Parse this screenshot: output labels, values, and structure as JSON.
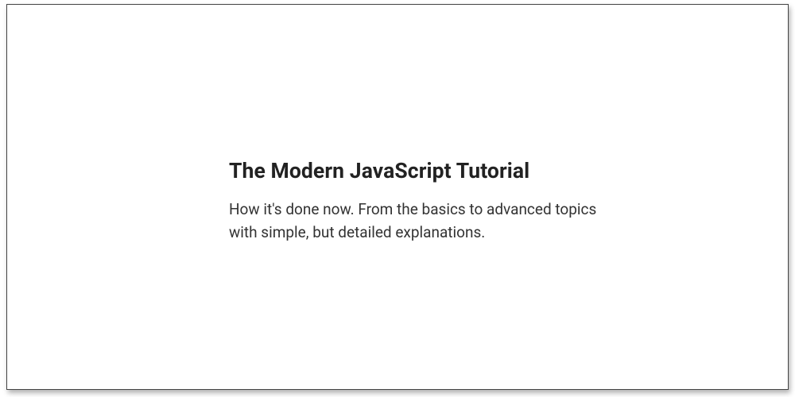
{
  "hero": {
    "title": "The Modern JavaScript Tutorial",
    "subtitle": "How it's done now. From the basics to advanced topics with simple, but detailed explanations."
  }
}
